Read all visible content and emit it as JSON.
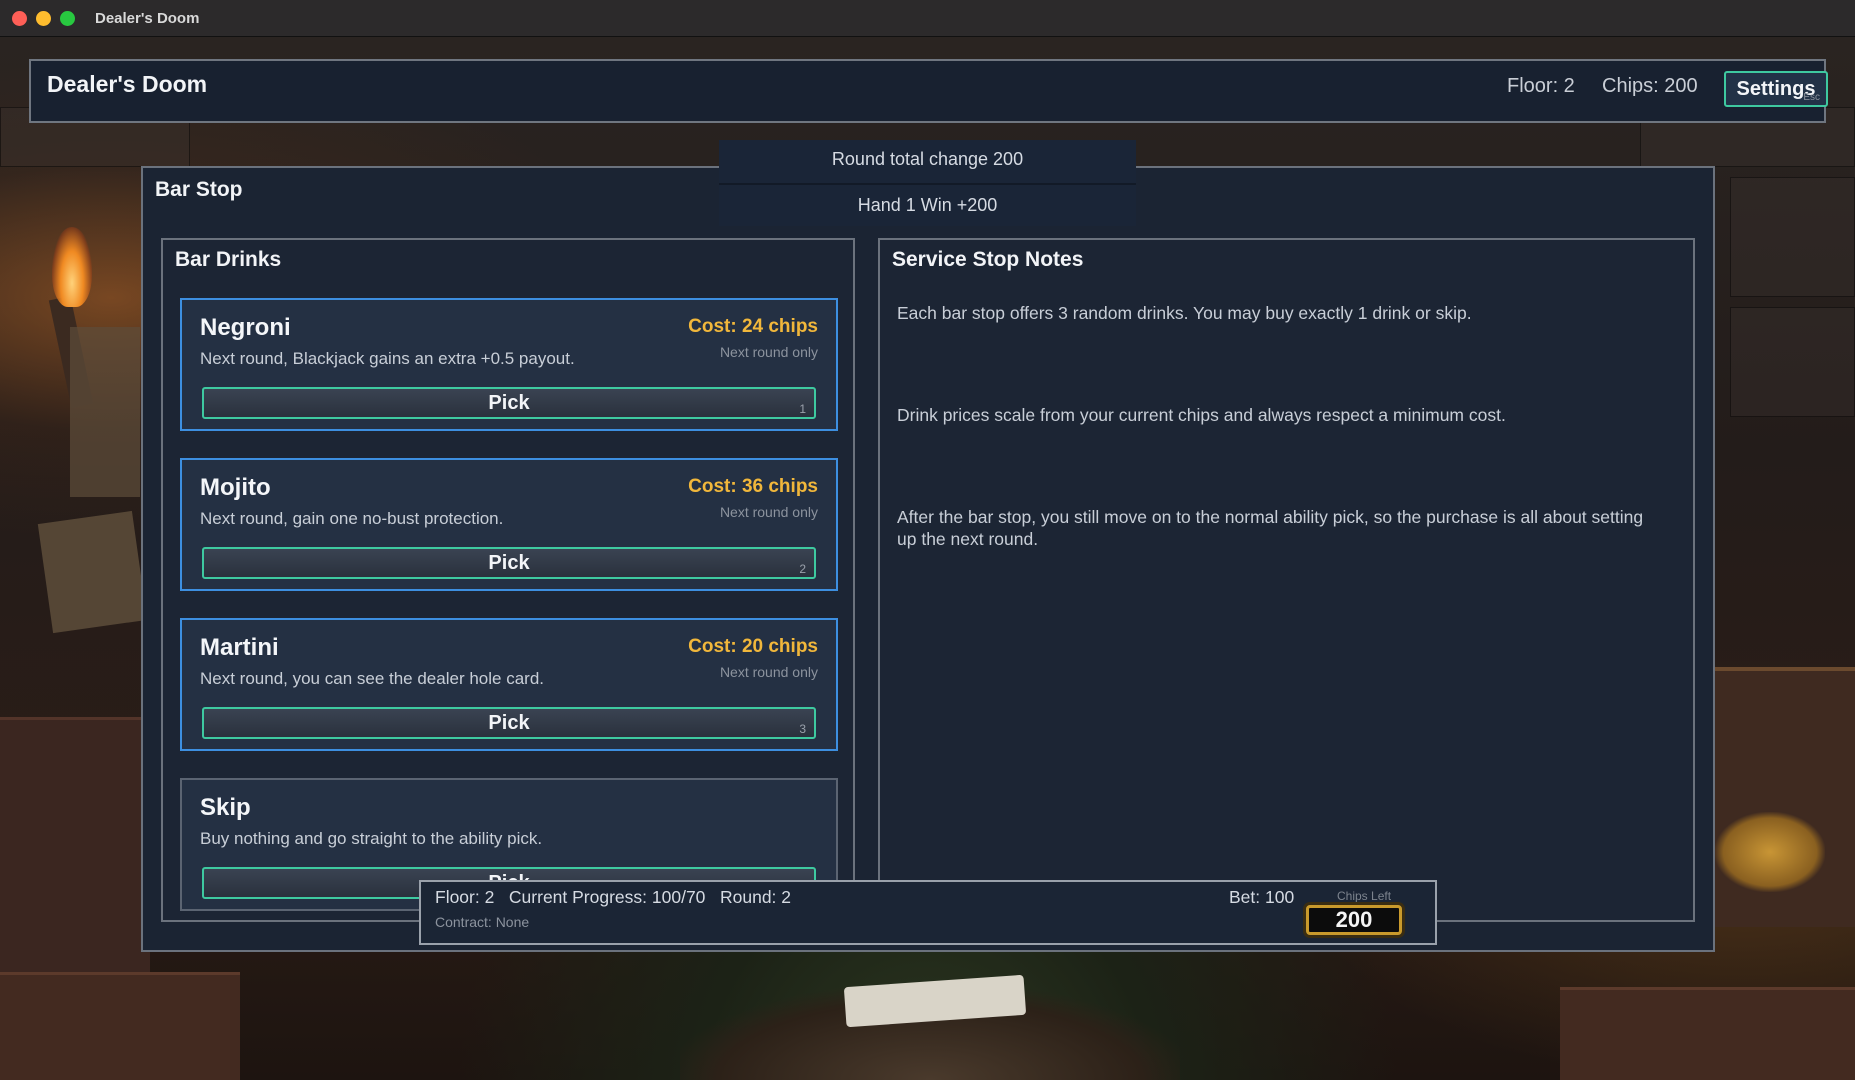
{
  "window": {
    "title": "Dealer's Doom"
  },
  "header": {
    "title": "Dealer's Doom",
    "floor": "Floor: 2",
    "chips": "Chips: 200",
    "settings_label": "Settings",
    "settings_hint": "Esc"
  },
  "toast": {
    "round_change": "Round total change 200",
    "hand_result": "Hand 1 Win +200"
  },
  "bar_stop": {
    "title": "Bar Stop",
    "drinks_heading": "Bar Drinks",
    "drinks": [
      {
        "name": "Negroni",
        "description": "Next round, Blackjack gains an extra +0.5 payout.",
        "cost": "Cost: 24 chips",
        "duration": "Next round only",
        "button": "Pick",
        "key": "1"
      },
      {
        "name": "Mojito",
        "description": "Next round, gain one no-bust protection.",
        "cost": "Cost: 36 chips",
        "duration": "Next round only",
        "button": "Pick",
        "key": "2"
      },
      {
        "name": "Martini",
        "description": "Next round, you can see the dealer hole card.",
        "cost": "Cost: 20 chips",
        "duration": "Next round only",
        "button": "Pick",
        "key": "3"
      }
    ],
    "skip": {
      "name": "Skip",
      "description": "Buy nothing and go straight to the ability pick.",
      "button": "Pick"
    },
    "notes_heading": "Service Stop Notes",
    "notes": [
      "Each bar stop offers 3 random drinks. You may buy exactly 1 drink or skip.",
      "Drink prices scale from your current chips and always respect a minimum cost.",
      "After the bar stop, you still move on to the normal ability pick, so the purchase is all about setting up the next round."
    ]
  },
  "status_bar": {
    "summary": "Floor: 2   Current Progress: 100/70   Round: 2",
    "contract": "Contract: None",
    "bet": "Bet: 100",
    "chips_left_label": "Chips Left",
    "chips_left_value": "200"
  },
  "colors": {
    "accent_teal": "#3ec9a0",
    "card_border_blue": "#3d8fe0",
    "cost_gold": "#f1b73b",
    "panel_bg": "#1c2534"
  }
}
